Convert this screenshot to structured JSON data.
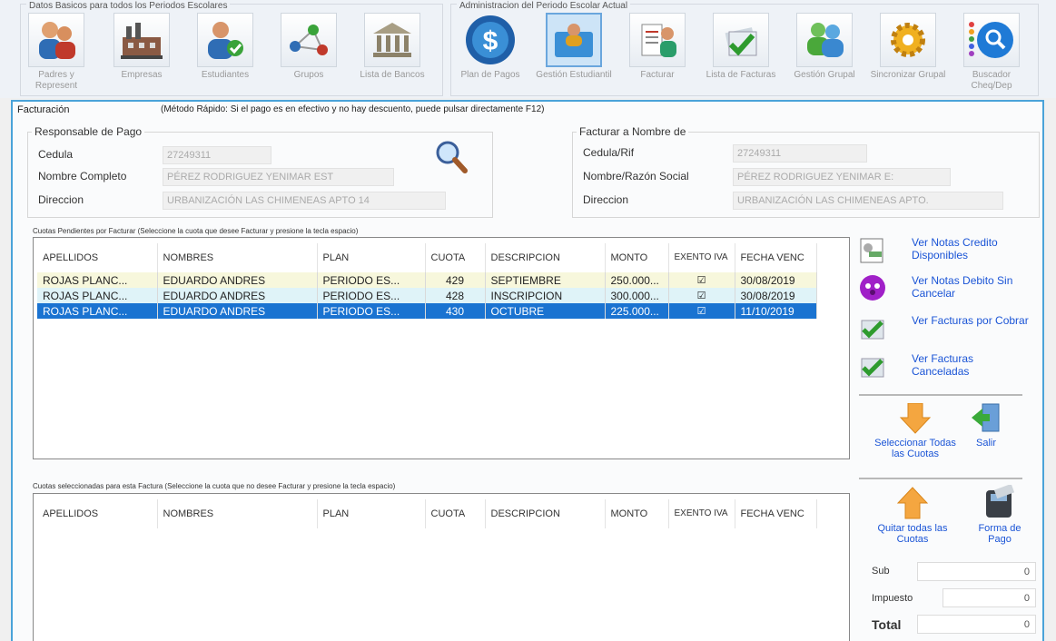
{
  "ribbon": {
    "group1_title": "Datos Basicos para todos los Periodos Escolares",
    "group2_title": "Administracion del Periodo Escolar Actual",
    "buttons": [
      {
        "label": "Padres y Represent"
      },
      {
        "label": "Empresas"
      },
      {
        "label": "Estudiantes"
      },
      {
        "label": "Grupos"
      },
      {
        "label": "Lista de Bancos"
      },
      {
        "label": "Plan de Pagos"
      },
      {
        "label": "Gestión Estudiantil"
      },
      {
        "label": "Facturar"
      },
      {
        "label": "Lista de Facturas"
      },
      {
        "label": "Gestión Grupal"
      },
      {
        "label": "Sincronizar Grupal"
      },
      {
        "label": "Buscador Cheq/Dep"
      }
    ],
    "active_button": "Gestión Estudiantil"
  },
  "facturacion": {
    "title": "Facturación",
    "hint": "(Método Rápido: Si el pago es en efectivo y no hay descuento, puede pulsar directamente F12)"
  },
  "responsable": {
    "legend": "Responsable de Pago",
    "cedula_label": "Cedula",
    "cedula_value": "27249311",
    "nombre_label": "Nombre Completo",
    "nombre_value": "PÉREZ RODRIGUEZ YENIMAR EST",
    "direccion_label": "Direccion",
    "direccion_value": "URBANIZACIÓN LAS CHIMENEAS APTO 14"
  },
  "facturar_a": {
    "legend": "Facturar a Nombre de",
    "cedula_label": "Cedula/Rif",
    "cedula_value": "27249311",
    "nombre_label": "Nombre/Razón Social",
    "nombre_value": "PÉREZ RODRIGUEZ YENIMAR E:",
    "direccion_label": "Direccion",
    "direccion_value": "URBANIZACIÓN LAS CHIMENEAS APTO."
  },
  "pendientes": {
    "label": "Cuotas Pendientes por Facturar (Seleccione la cuota que desee Facturar y presione la tecla espacio)",
    "columns": [
      "APELLIDOS",
      "NOMBRES",
      "PLAN",
      "CUOTA",
      "DESCRIPCION",
      "MONTO",
      "EXENTO IVA",
      "FECHA VENC"
    ],
    "rows": [
      {
        "apellidos": "ROJAS PLANC...",
        "nombres": "EDUARDO ANDRES",
        "plan": "PERIODO ES...",
        "cuota": "429",
        "descripcion": "SEPTIEMBRE",
        "monto": "250.000...",
        "exento": "☑",
        "fecha": "30/08/2019"
      },
      {
        "apellidos": "ROJAS PLANC...",
        "nombres": "EDUARDO ANDRES",
        "plan": "PERIODO ES...",
        "cuota": "428",
        "descripcion": "INSCRIPCION",
        "monto": "300.000...",
        "exento": "☑",
        "fecha": "30/08/2019"
      },
      {
        "apellidos": "ROJAS PLANC...",
        "nombres": "EDUARDO ANDRES",
        "plan": "PERIODO ES...",
        "cuota": "430",
        "descripcion": "OCTUBRE",
        "monto": "225.000...",
        "exento": "☑",
        "fecha": "11/10/2019"
      }
    ]
  },
  "seleccionadas": {
    "label": "Cuotas seleccionadas para esta Factura (Seleccione la cuota que no desee Facturar y presione la tecla espacio)",
    "columns": [
      "APELLIDOS",
      "NOMBRES",
      "PLAN",
      "CUOTA",
      "DESCRIPCION",
      "MONTO",
      "EXENTO IVA",
      "FECHA VENC"
    ]
  },
  "side": {
    "notas_credito": "Ver Notas Credito Disponibles",
    "notas_debito": "Ver Notas Debito Sin Cancelar",
    "facturas_cobrar": "Ver Facturas por Cobrar",
    "facturas_canceladas": "Ver Facturas Canceladas",
    "seleccionar_todas": "Seleccionar Todas las Cuotas",
    "salir": "Salir",
    "quitar_todas": "Quitar todas las Cuotas",
    "forma_pago": "Forma de Pago"
  },
  "totals": {
    "sub_label": "Sub",
    "sub_value": "0",
    "impuesto_label": "Impuesto",
    "impuesto_value": "0",
    "total_label": "Total",
    "total_value": "0"
  }
}
